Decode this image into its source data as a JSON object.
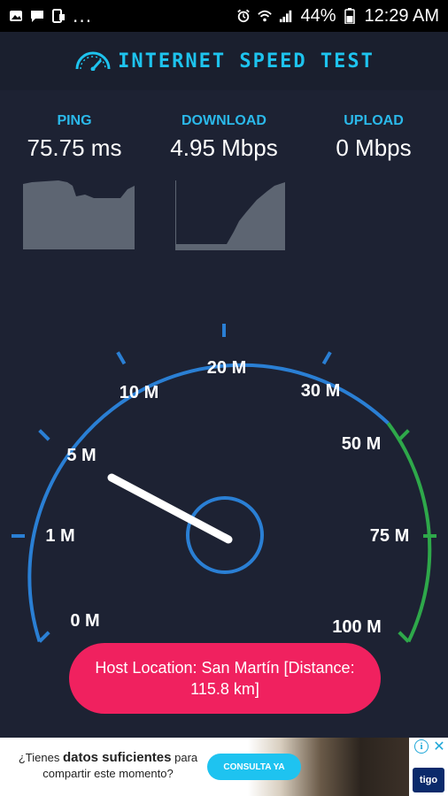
{
  "status_bar": {
    "battery_percent": "44%",
    "time": "12:29 AM",
    "overflow": "..."
  },
  "header": {
    "title": "INTERNET SPEED TEST",
    "accent_color": "#1ec3ee"
  },
  "stats": {
    "ping": {
      "label": "PING",
      "value": "75.75 ms"
    },
    "download": {
      "label": "DOWNLOAD",
      "value": "4.95 Mbps"
    },
    "upload": {
      "label": "UPLOAD",
      "value": "0 Mbps"
    }
  },
  "gauge": {
    "labels": [
      "0 M",
      "1 M",
      "5 M",
      "10 M",
      "20 M",
      "30 M",
      "50 M",
      "75 M",
      "100 M"
    ],
    "needle_value_mbps": 4.95,
    "arc_color": "#2a7fd4",
    "high_range_color": "#2ea84a"
  },
  "host": {
    "text": "Host Location: San Martín [Distance: 115.8 km]",
    "color": "#f0215f"
  },
  "ad": {
    "text_prefix": "¿Tienes ",
    "text_bold": "datos suficientes",
    "text_mid": " para",
    "text_line2": "compartir este momento?",
    "cta": "CONSULTA YA",
    "brand": "tigo"
  }
}
